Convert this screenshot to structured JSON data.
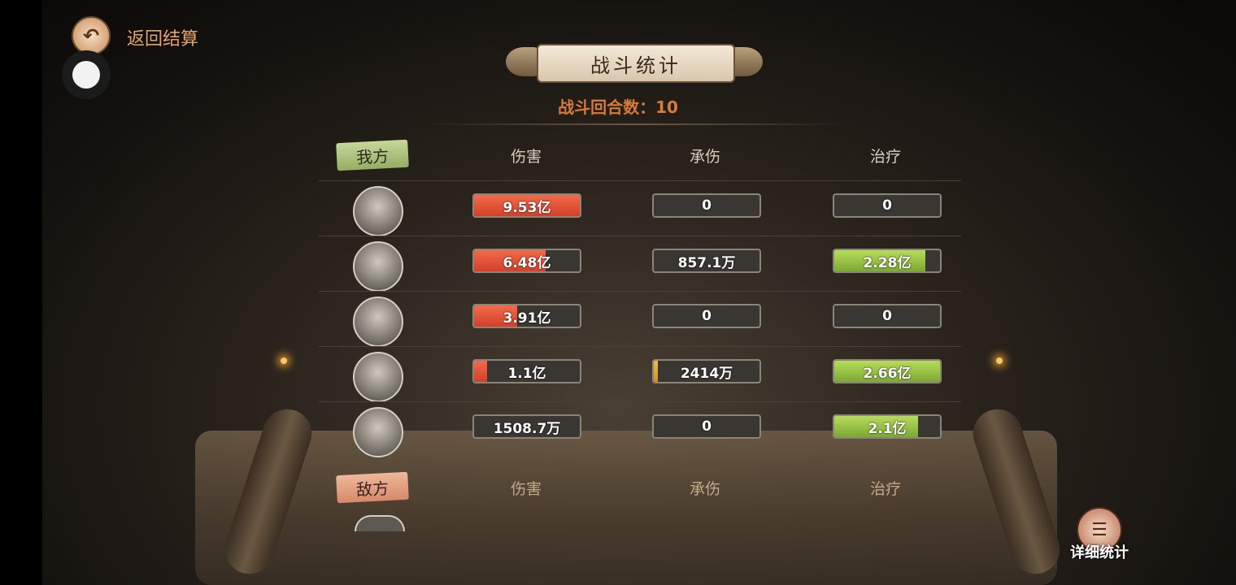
{
  "header": {
    "back_label": "返回结算",
    "title": "战斗统计",
    "rounds_text": "战斗回合数：10"
  },
  "our_side": {
    "tag": "我方",
    "columns": [
      "伤害",
      "承伤",
      "治疗"
    ],
    "rows": [
      {
        "damage": "9.53亿",
        "damage_fill": 1.0,
        "taken": "0",
        "taken_fill": 0,
        "heal": "0",
        "heal_fill": 0
      },
      {
        "damage": "6.48亿",
        "damage_fill": 0.68,
        "taken": "857.1万",
        "taken_fill": 0,
        "heal": "2.28亿",
        "heal_fill": 0.86
      },
      {
        "damage": "3.91亿",
        "damage_fill": 0.41,
        "taken": "0",
        "taken_fill": 0,
        "heal": "0",
        "heal_fill": 0
      },
      {
        "damage": "1.1亿",
        "damage_fill": 0.12,
        "taken": "2414万",
        "taken_fill": 0.04,
        "heal": "2.66亿",
        "heal_fill": 1.0
      },
      {
        "damage": "1508.7万",
        "damage_fill": 0,
        "taken": "0",
        "taken_fill": 0,
        "heal": "2.1亿",
        "heal_fill": 0.79
      }
    ]
  },
  "enemy_side": {
    "tag": "敌方",
    "columns": [
      "伤害",
      "承伤",
      "治疗"
    ]
  },
  "detail_button": {
    "label": "详细统计"
  },
  "colors": {
    "damage": "#e04a30",
    "heal": "#97c447",
    "taken": "#e8a73a",
    "accent": "#d87a3a"
  }
}
